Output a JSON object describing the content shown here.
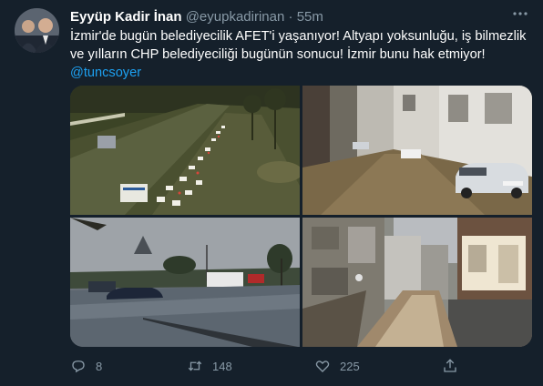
{
  "tweet": {
    "author_name": "Eyyüp Kadir İnan",
    "author_handle": "@eyupkadirinan",
    "separator": "·",
    "time": "55m",
    "text": "İzmir'de bugün belediyecilik AFET'i yaşanıyor! Altyapı yoksunluğu, iş bilmezlik ve yılların CHP belediyeciliği bugünün sonucu! İzmir bunu hak etmiyor! ",
    "mention": "@tuncsoyer"
  },
  "actions": {
    "reply_count": "8",
    "retweet_count": "148",
    "like_count": "225"
  },
  "icons": {
    "more": "more-icon",
    "reply": "reply-icon",
    "retweet": "retweet-icon",
    "like": "heart-icon",
    "share": "share-icon"
  },
  "colors": {
    "background": "#15202b",
    "secondary_text": "#8899a6",
    "link": "#1da1f2"
  }
}
